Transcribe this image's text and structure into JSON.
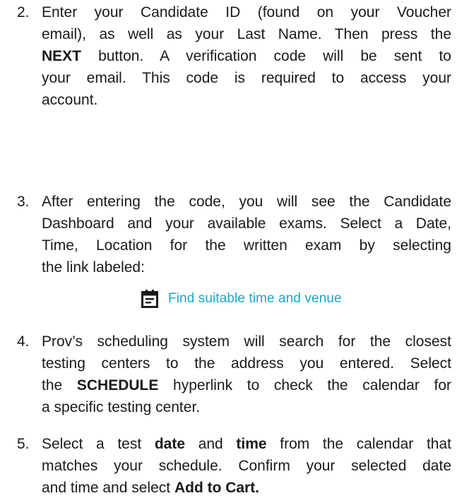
{
  "steps": [
    {
      "number": "2.",
      "lines": [
        [
          {
            "t": "Enter your Candidate ID (found on your Voucher"
          }
        ],
        [
          {
            "t": "email), as well as your Last Name.  Then press the"
          }
        ],
        [
          {
            "t": "NEXT",
            "b": true
          },
          {
            "t": " button. A verification code will be sent to"
          }
        ],
        [
          {
            "t": "your email. This code is required to access your"
          }
        ],
        [
          {
            "t": "account."
          }
        ]
      ]
    },
    {
      "number": "3.",
      "lines": [
        [
          {
            "t": "After entering the code, you will see the Candidate"
          }
        ],
        [
          {
            "t": "Dashboard and your available exams. Select a Date,"
          }
        ],
        [
          {
            "t": "Time, Location for the written exam by selecting"
          }
        ],
        [
          {
            "t": "the link labeled:"
          }
        ]
      ]
    },
    {
      "number": "4.",
      "lines": [
        [
          {
            "t": "Prov’s scheduling system will search for the closest"
          }
        ],
        [
          {
            "t": "testing centers to the address you entered.  Select"
          }
        ],
        [
          {
            "t": "the "
          },
          {
            "t": "SCHEDULE",
            "b": true
          },
          {
            "t": " hyperlink to check the calendar for"
          }
        ],
        [
          {
            "t": "a specific testing center."
          }
        ]
      ]
    },
    {
      "number": "5.",
      "lines": [
        [
          {
            "t": "Select a test "
          },
          {
            "t": "date",
            "b": true
          },
          {
            "t": " and "
          },
          {
            "t": "time",
            "b": true
          },
          {
            "t": " from the calendar that"
          }
        ],
        [
          {
            "t": "matches your schedule. Confirm your selected date"
          }
        ],
        [
          {
            "t": "and time and select "
          },
          {
            "t": "Add to Cart.",
            "b": true
          }
        ]
      ]
    }
  ],
  "find_link": {
    "label": "Find suitable time and venue",
    "icon": "calendar-icon",
    "color": "#1ba6c9"
  }
}
